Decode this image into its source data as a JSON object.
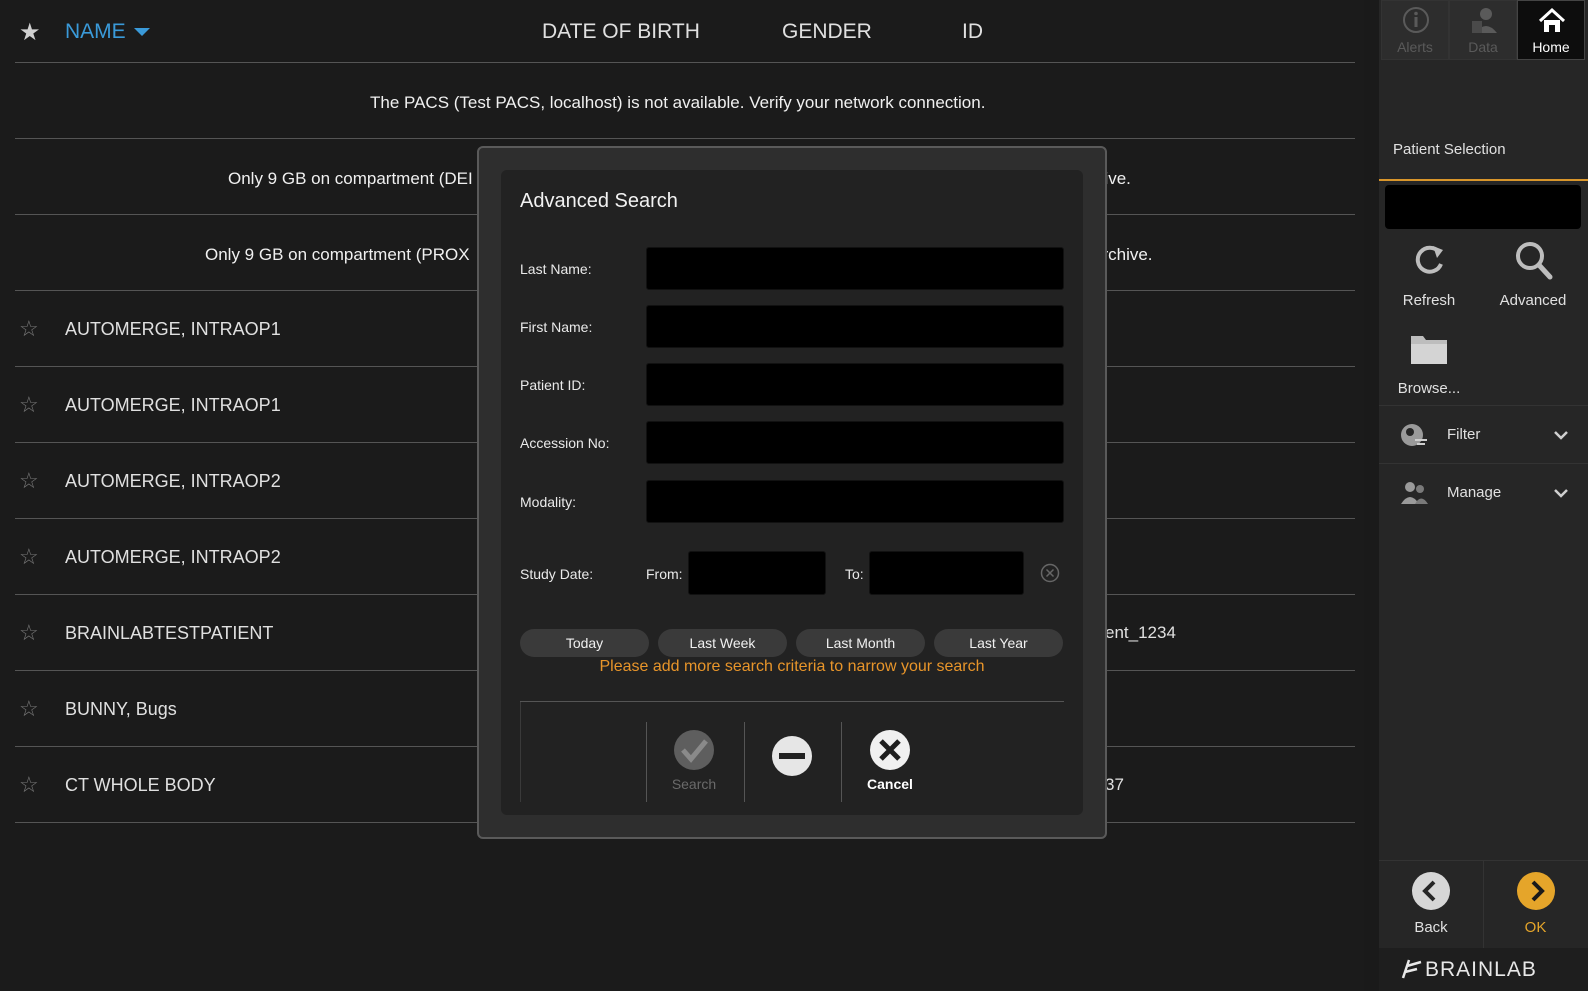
{
  "header": {
    "name_label": "NAME",
    "dob_label": "DATE OF BIRTH",
    "gender_label": "GENDER",
    "id_label": "ID"
  },
  "messages": [
    "The PACS (Test PACS, localhost) is not available. Verify your network connection.",
    "Only 9 GB on compartment (DEI",
    "hive.",
    "Only 9 GB on compartment (PROX",
    "archive."
  ],
  "patients": [
    {
      "name": "AUTOMERGE, INTRAOP1",
      "id": ""
    },
    {
      "name": "AUTOMERGE, INTRAOP1",
      "id": ""
    },
    {
      "name": "AUTOMERGE, INTRAOP2",
      "id": ""
    },
    {
      "name": "AUTOMERGE, INTRAOP2",
      "id": ""
    },
    {
      "name": "BRAINLABTESTPATIENT",
      "id": "ent_1234"
    },
    {
      "name": "BUNNY, Bugs",
      "id": ""
    },
    {
      "name": "CT WHOLE BODY",
      "id": "37"
    }
  ],
  "sidebar": {
    "top_buttons": [
      "Alerts",
      "Data",
      "Home"
    ],
    "section_title": "Patient Selection",
    "search_value": "",
    "refresh_label": "Refresh",
    "advanced_label": "Advanced",
    "browse_label": "Browse...",
    "filter_label": "Filter",
    "manage_label": "Manage",
    "back_label": "Back",
    "ok_label": "OK",
    "logo_text": "BRAINLAB"
  },
  "modal": {
    "title": "Advanced Search",
    "fields": [
      {
        "label": "Last Name:",
        "value": ""
      },
      {
        "label": "First Name:",
        "value": ""
      },
      {
        "label": "Patient ID:",
        "value": ""
      },
      {
        "label": "Accession No:",
        "value": ""
      },
      {
        "label": "Modality:",
        "value": ""
      }
    ],
    "study_date_label": "Study Date:",
    "from_label": "From:",
    "to_label": "To:",
    "quick_ranges": [
      "Today",
      "Last Week",
      "Last Month",
      "Last Year"
    ],
    "warning": "Please add more search criteria to narrow your search",
    "search_label": "Search",
    "cancel_label": "Cancel"
  },
  "colors": {
    "accent_blue": "#3a9ad9",
    "accent_orange": "#d9962b",
    "warning_orange": "#e8952a"
  }
}
